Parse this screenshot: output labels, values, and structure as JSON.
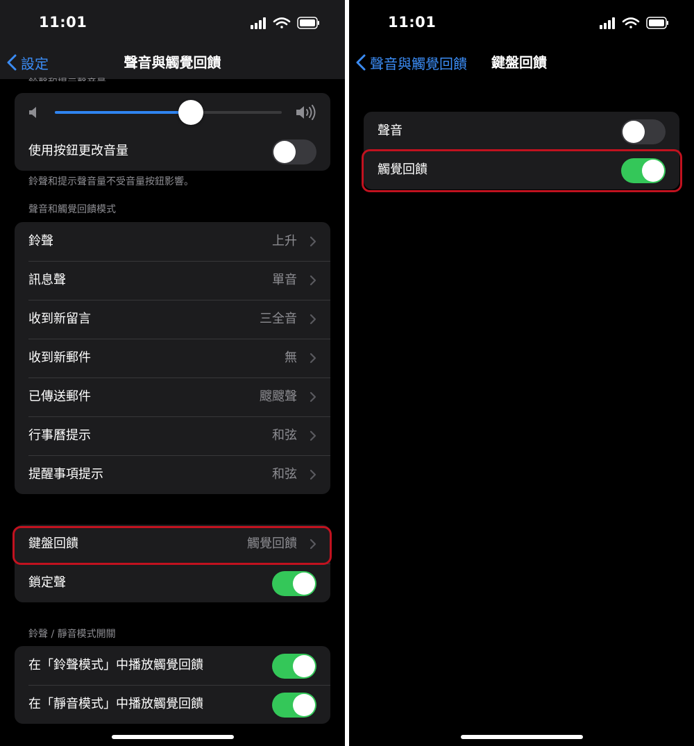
{
  "left": {
    "status": {
      "time": "11:01"
    },
    "nav": {
      "back_label": "設定",
      "title": "聲音與觸覺回饋"
    },
    "volume_header": "鈴聲和提示聲音量",
    "volume": {
      "level": 0.6,
      "change_with_buttons_label": "使用按鈕更改音量",
      "change_with_buttons_on": false
    },
    "volume_footer": "鈴聲和提示聲音量不受音量按鈕影響。",
    "patterns_header": "聲音和觸覺回饋模式",
    "patterns": [
      {
        "label": "鈴聲",
        "value": "上升"
      },
      {
        "label": "訊息聲",
        "value": "單音"
      },
      {
        "label": "收到新留言",
        "value": "三全音"
      },
      {
        "label": "收到新郵件",
        "value": "無"
      },
      {
        "label": "已傳送郵件",
        "value": "颼颼聲"
      },
      {
        "label": "行事曆提示",
        "value": "和弦"
      },
      {
        "label": "提醒事項提示",
        "value": "和弦"
      }
    ],
    "keyboard": {
      "label": "鍵盤回饋",
      "value": "觸覺回饋"
    },
    "lock": {
      "label": "鎖定聲",
      "on": true
    },
    "switch_header": "鈴聲 / 靜音模式開關",
    "switch_rows": [
      {
        "label": "在「鈴聲模式」中播放觸覺回饋",
        "on": true
      },
      {
        "label": "在「靜音模式」中播放觸覺回饋",
        "on": true
      }
    ]
  },
  "right": {
    "status": {
      "time": "11:01"
    },
    "nav": {
      "back_label": "聲音與觸覺回饋",
      "title": "鍵盤回饋"
    },
    "rows": [
      {
        "label": "聲音",
        "on": false
      },
      {
        "label": "觸覺回饋",
        "on": true
      }
    ]
  },
  "colors": {
    "accent": "#3b8cf5",
    "toggle_on": "#34c759",
    "highlight": "#c1121f",
    "cell": "#1c1c1e"
  },
  "icons": [
    "signal-icon",
    "wifi-icon",
    "battery-icon",
    "chevron-left-icon",
    "chevron-right-icon",
    "speaker-low-icon",
    "speaker-high-icon"
  ]
}
